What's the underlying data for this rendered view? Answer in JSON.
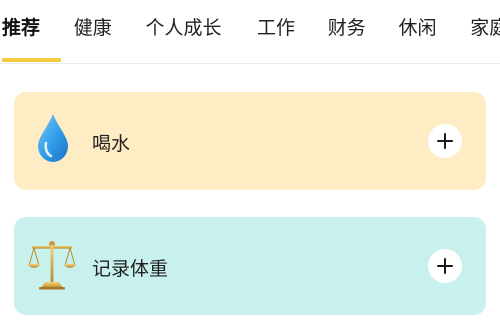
{
  "tabs": [
    {
      "label": "推荐",
      "active": true
    },
    {
      "label": "健康",
      "active": false
    },
    {
      "label": "个人成长",
      "active": false
    },
    {
      "label": "工作",
      "active": false
    },
    {
      "label": "财务",
      "active": false
    },
    {
      "label": "休闲",
      "active": false
    },
    {
      "label": "家庭",
      "active": false
    }
  ],
  "cards": [
    {
      "title": "喝水",
      "icon": "water-drop-icon",
      "background": "#feecc4",
      "add_icon": "plus-icon"
    },
    {
      "title": "记录体重",
      "icon": "balance-scale-icon",
      "background": "#c8f0ec",
      "add_icon": "plus-icon"
    }
  ],
  "colors": {
    "tab_indicator": "#f5cc3f",
    "water_card": "#feecc4",
    "weight_card": "#c8f0ec",
    "drop_blue": "#2f9de8"
  }
}
